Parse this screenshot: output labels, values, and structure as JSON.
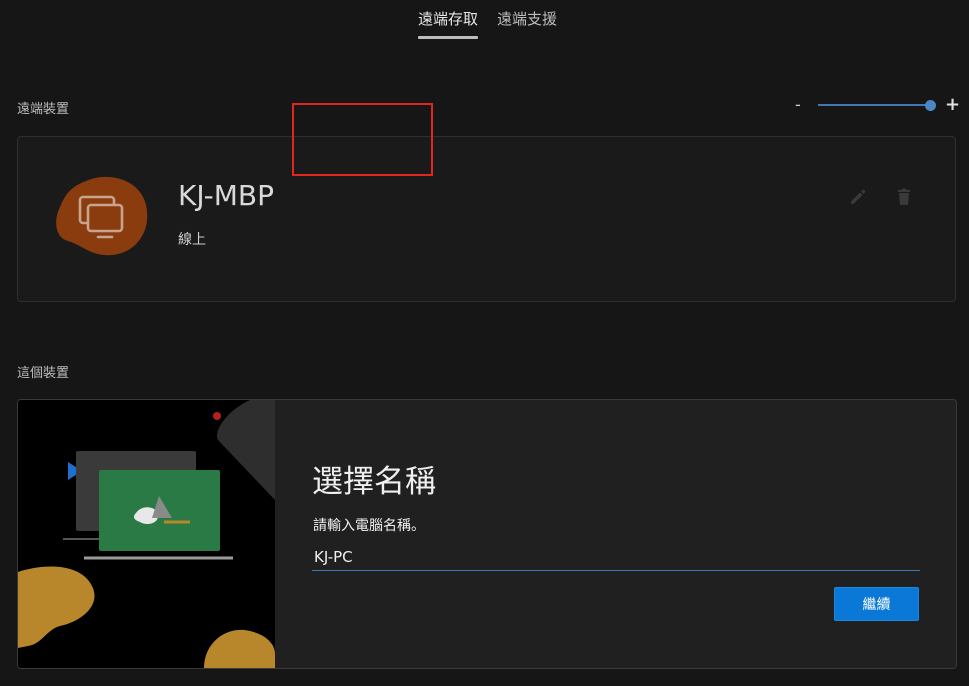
{
  "tabs": [
    {
      "label": "遠端存取",
      "active": true
    },
    {
      "label": "遠端支援",
      "active": false
    }
  ],
  "remote_devices": {
    "section_title": "遠端裝置",
    "zoom": {
      "minus_label": "-",
      "plus_label": "+",
      "level": 1.0
    },
    "devices": [
      {
        "name": "KJ-MBP",
        "status": "線上",
        "avatar_color": "#8a3c0f",
        "icon": "remote-desktop-icon"
      }
    ]
  },
  "this_device": {
    "section_title": "這個裝置",
    "form": {
      "title": "選擇名稱",
      "label": "請輸入電腦名稱。",
      "input_value": "KJ-PC",
      "continue_label": "繼續"
    }
  },
  "colors": {
    "accent": "#0a78d6",
    "slider": "#3f78b5",
    "highlight": "#e0261d",
    "avatar": "#8a3c0f",
    "illustration_green": "#2a7a46",
    "illustration_gold": "#b8862b"
  }
}
